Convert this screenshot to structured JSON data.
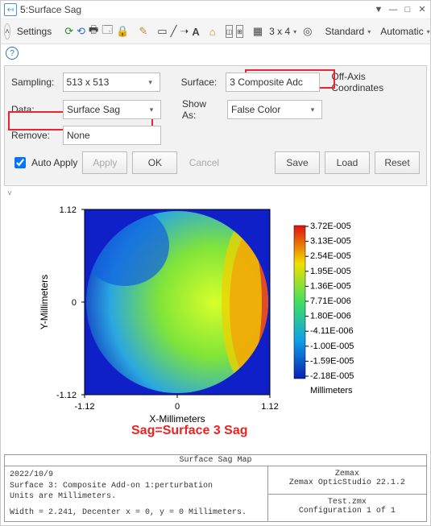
{
  "window": {
    "index": "5",
    "title": "Surface Sag"
  },
  "toolbar": {
    "settings": "Settings",
    "grid": "3 x 4",
    "std": "Standard",
    "auto": "Automatic"
  },
  "panel": {
    "labels": {
      "sampling": "Sampling:",
      "data": "Data:",
      "remove": "Remove:",
      "surface": "Surface:",
      "showas": "Show As:",
      "offaxis": "Off-Axis Coordinates"
    },
    "sampling": "513 x 513",
    "data": "Surface Sag",
    "remove": "None",
    "surface": "3 Composite Adc",
    "showas": "False Color",
    "buttons": {
      "autoapply": "Auto Apply",
      "apply": "Apply",
      "ok": "OK",
      "cancel": "Cancel",
      "save": "Save",
      "load": "Load",
      "reset": "Reset"
    }
  },
  "plot": {
    "xlabel": "X-Millimeters",
    "ylabel": "Y-Millimeters",
    "y_hi": "1.12",
    "y_mid": "0",
    "y_lo": "-1.12",
    "x_lo": "-1.12",
    "x_mid": "0",
    "x_hi": "1.12",
    "cbar_unit": "Millimeters",
    "annot": "Sag=Surface 3 Sag",
    "cbar": [
      "3.72E-005",
      "3.13E-005",
      "2.54E-005",
      "1.95E-005",
      "1.36E-005",
      "7.71E-006",
      "1.80E-006",
      "-4.11E-006",
      "-1.00E-005",
      "-1.59E-005",
      "-2.18E-005"
    ]
  },
  "chart_data": {
    "type": "heatmap",
    "title": "Surface Sag Map",
    "xlabel": "X-Millimeters",
    "ylabel": "Y-Millimeters",
    "xlim": [
      -1.12,
      1.12
    ],
    "ylim": [
      -1.12,
      1.12
    ],
    "zlim": [
      -2.18e-05,
      3.72e-05
    ],
    "zunit": "Millimeters",
    "mask": "circle r=1.12",
    "colorbar_ticks": [
      3.72e-05,
      3.13e-05,
      2.54e-05,
      1.95e-05,
      1.36e-05,
      7.71e-06,
      1.8e-06,
      -4.11e-06,
      -1e-05,
      -1.59e-05,
      -2.18e-05
    ],
    "note": "False-color sag map over circular aperture; gradient roughly low at upper-left (blue) to high at right edge (red)."
  },
  "info": {
    "header": "Surface Sag Map",
    "l1": "2022/10/9",
    "l2": "Surface 3: Composite Add-on 1:perturbation",
    "l3": "Units are Millimeters.",
    "l4": "Width = 2.241, Decenter x = 0, y = 0 Millimeters.",
    "r1": "Zemax",
    "r2": "Zemax OpticStudio 22.1.2",
    "r3": "Test.zmx",
    "r4": "Configuration 1 of 1"
  }
}
